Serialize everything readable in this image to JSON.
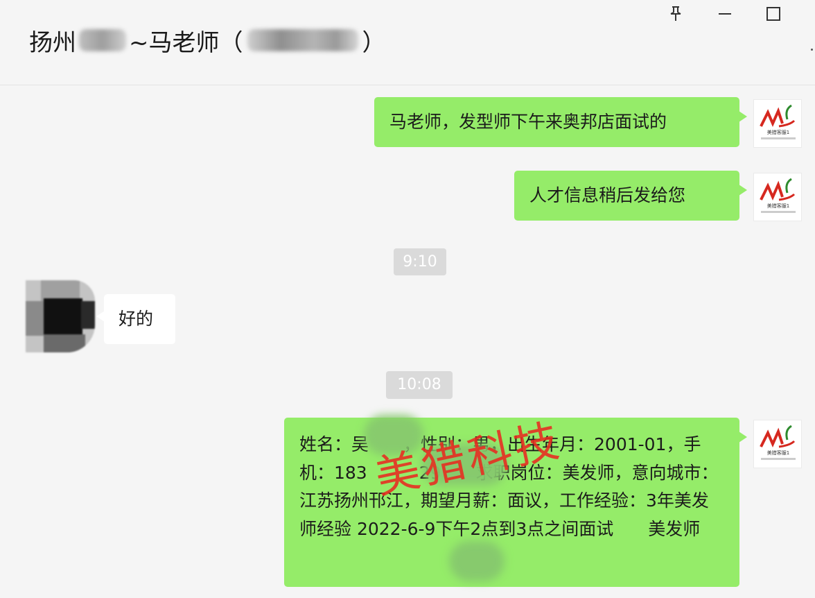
{
  "header": {
    "title_prefix": "扬州",
    "title_middle": "~马老师（",
    "title_suffix": "）",
    "controls": [
      "pin-icon",
      "minimize-icon",
      "maximize-icon"
    ]
  },
  "messages": {
    "m1": "马老师，发型师下午来奥邦店面试的",
    "m2": "人才信息稍后发给您",
    "time1": "9:10",
    "m3": "好的",
    "time2": "10:08",
    "m4": "姓名：吴　　，性别：男，出生年月：2001-01，手机：183　　　29　　求职岗位：美发师，意向城市：江苏扬州邗江，期望月薪：面议，工作经验：3年美发师经验 2022-6-9下午2点到3点之间面试　　美发师"
  },
  "avatar": {
    "sender_logo_caption": "美猎客服1"
  },
  "watermark": "美猎科技",
  "colors": {
    "sent_bubble": "#95ec69",
    "received_bubble": "#ffffff",
    "background": "#f5f5f5",
    "watermark": "#e82a20"
  }
}
